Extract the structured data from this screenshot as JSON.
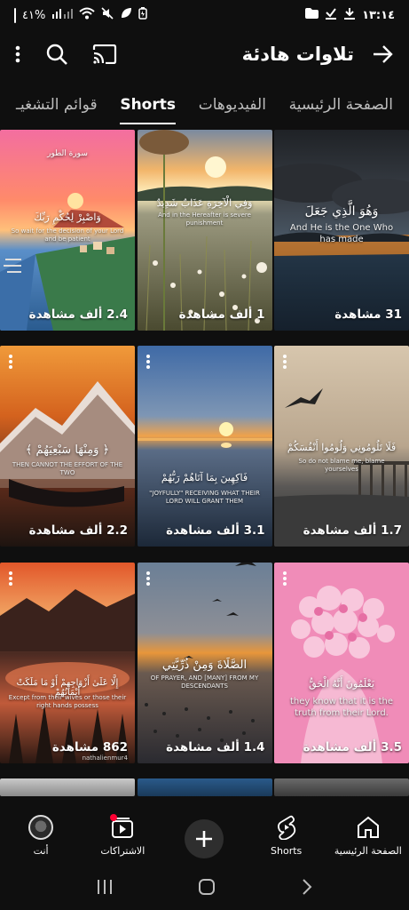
{
  "status_bar": {
    "battery_text": "%٤١",
    "time": "١٣:١٤"
  },
  "header": {
    "title": "تلاوات هادئة",
    "icons": [
      "more-vert-icon",
      "search-icon",
      "cast-icon",
      "arrow-forward-icon"
    ]
  },
  "tabs": [
    {
      "label": "قوائم التشغيـ",
      "active": false
    },
    {
      "label": "Shorts",
      "active": true
    },
    {
      "label": "الفيديوهات",
      "active": false
    },
    {
      "label": "الصفحة الرئيسية",
      "active": false
    }
  ],
  "shorts": [
    {
      "views": "2.4 ألف مشاهدة",
      "caption_ar": "وَاصْبِرْ لِحُكْمِ رَبِّكَ",
      "caption_en": "So wait for the decision of your Lord and be patient",
      "top_ar": "سورة الطور",
      "colors": [
        "#f06fa0",
        "#ff7a63",
        "#3f6fae"
      ]
    },
    {
      "views": "1 ألف مشاهدة",
      "caption_ar": "وَفِي الْآخِرَةِ عَذَابٌ شَدِيدٌ",
      "caption_en": "And in the Hereafter is severe punishment",
      "colors": [
        "#f1b46a",
        "#8d8f7a",
        "#4e5a3a"
      ]
    },
    {
      "views": "31 مشاهدة",
      "caption_ar": "وَهُوَ الَّذِي جَعَلَ",
      "caption_en": "And He is the One Who has made",
      "colors": [
        "#2a2c31",
        "#3d4a5a",
        "#1a2431"
      ]
    },
    {
      "views": "2.2 ألف مشاهدة",
      "caption_ar": "﴿ وَمِنْهَا سَبْعِيَهُمْ ﴾",
      "caption_en": "THEN CANNOT THE EFFORT OF THE TWO",
      "colors": [
        "#d9771e",
        "#7a3d22",
        "#2d1b16"
      ]
    },
    {
      "views": "3.1 ألف مشاهدة",
      "caption_ar": "فَاكِهِينَ بِمَا آتَاهُمْ رَبُّهُمْ",
      "caption_en": "\"JOYFULLY\" RECEIVING WHAT THEIR LORD WILL GRANT THEM",
      "colors": [
        "#4d6f9f",
        "#c47a3a",
        "#243447"
      ]
    },
    {
      "views": "1.7 ألف مشاهدة",
      "caption_ar": "فَلَا تَلُومُونِي وَلُومُوا أَنْفُسَكُمْ",
      "caption_en": "So do not blame me, blame yourselves",
      "colors": [
        "#c9b49a",
        "#8d8a82",
        "#3a3834"
      ]
    },
    {
      "views": "862 مشاهدة",
      "caption_ar": "إِلَّا عَلَىٰ أَزْوَاجِهِمْ أَوْ مَا مَلَكَتْ أَيْمَانُهُمْ",
      "caption_en": "Except from their wives or those their right hands possess",
      "watermark": "nathalienmur4",
      "colors": [
        "#d9612f",
        "#5b2a1e",
        "#2b1812"
      ]
    },
    {
      "views": "1.4 ألف مشاهدة",
      "caption_ar": "الصَّلَاةَ وَمِنْ ذُرِّيَّتِي",
      "caption_en": "OF PRAYER, AND [MANY] FROM MY DESCENDANTS",
      "colors": [
        "#6a8098",
        "#d48b3a",
        "#2e2f35"
      ]
    },
    {
      "views": "3.5 ألف مشاهدة",
      "caption_ar": "يَعْلَمُونَ أَنَّهُ الْحَقُّ",
      "caption_en": "they know that it is the truth from their Lord.",
      "colors": [
        "#f09ac0",
        "#f4b6d1",
        "#e77fb0"
      ]
    }
  ],
  "bottom_nav": [
    {
      "label": "الصفحة الرئيسية",
      "icon": "home-icon"
    },
    {
      "label": "Shorts",
      "icon": "shorts-icon"
    },
    {
      "label": "",
      "icon": "create-plus-icon"
    },
    {
      "label": "الاشتراكات",
      "icon": "subscriptions-icon"
    },
    {
      "label": "أنت",
      "icon": "avatar-icon"
    }
  ]
}
